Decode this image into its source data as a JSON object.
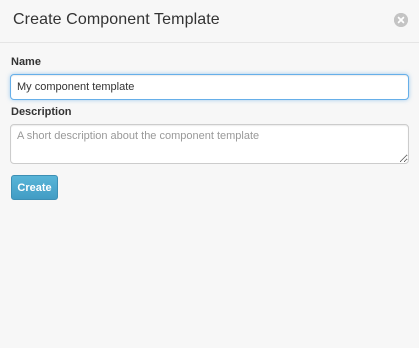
{
  "dialog": {
    "title": "Create Component Template",
    "close_icon": "close-circle-icon"
  },
  "form": {
    "name_label": "Name",
    "name_value": "My component template",
    "description_label": "Description",
    "description_value": "",
    "description_placeholder": "A short description about the component template",
    "submit_label": "Create"
  },
  "colors": {
    "focus_border": "#66afe9",
    "button_bg": "#4aa6cc",
    "background": "#f7f7f7"
  }
}
